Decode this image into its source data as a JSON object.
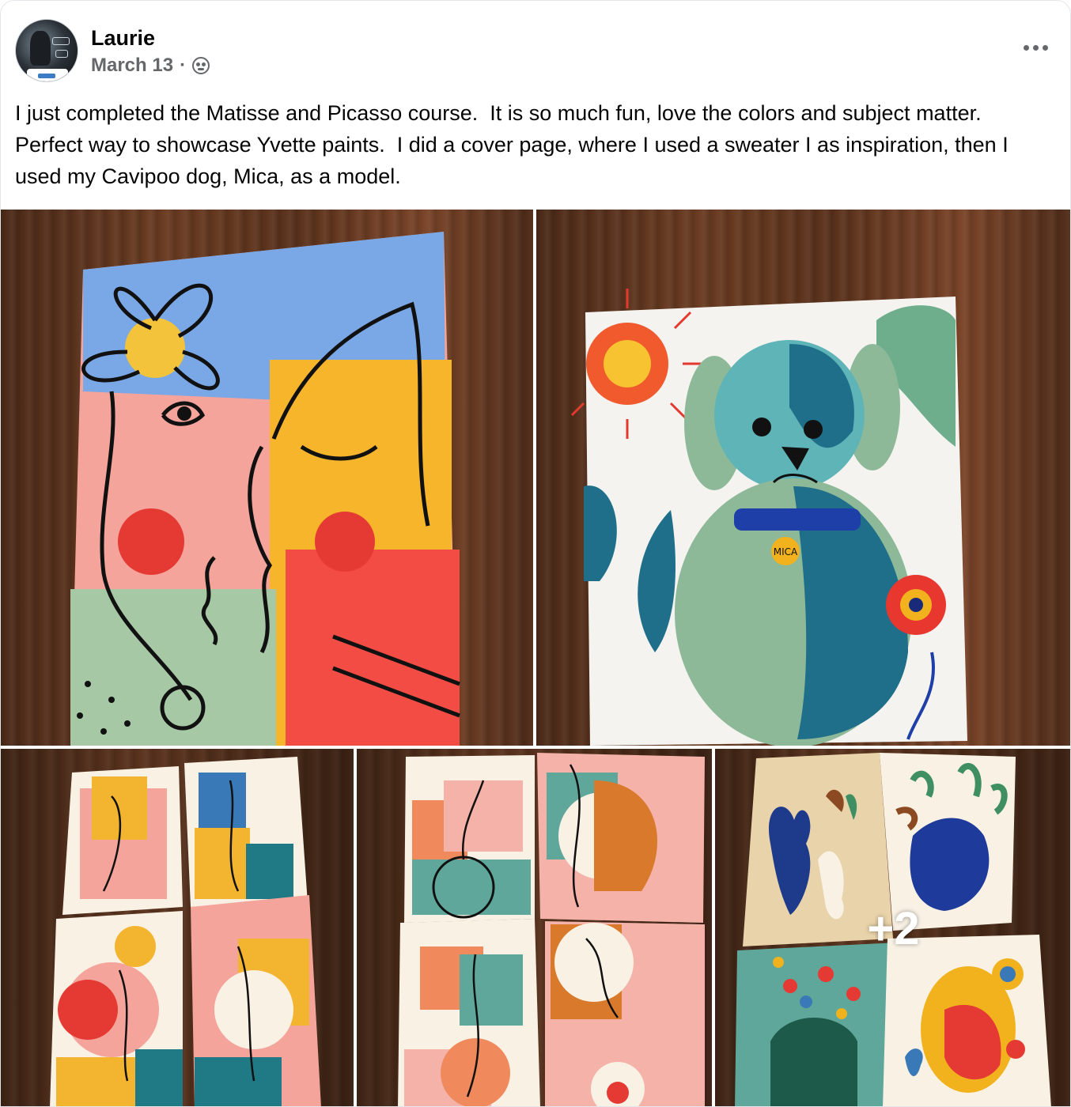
{
  "post": {
    "author": "Laurie",
    "date": "March 13",
    "separator": "·",
    "audience_icon": "friends-icon",
    "more_icon": "more-dots-icon",
    "text": "I just completed the Matisse and Picasso course.  It is so much fun, love the colors and subject matter.  Perfect way to showcase Yvette paints.  I did a cover page, where I used a sweater I as inspiration, then I used my Cavipoo dog, Mica, as a model.",
    "photos": {
      "tag_text": "MICA",
      "more_count": "+2"
    }
  },
  "colors": {
    "text": "#050505",
    "secondary": "#65676b",
    "background": "#ffffff"
  }
}
